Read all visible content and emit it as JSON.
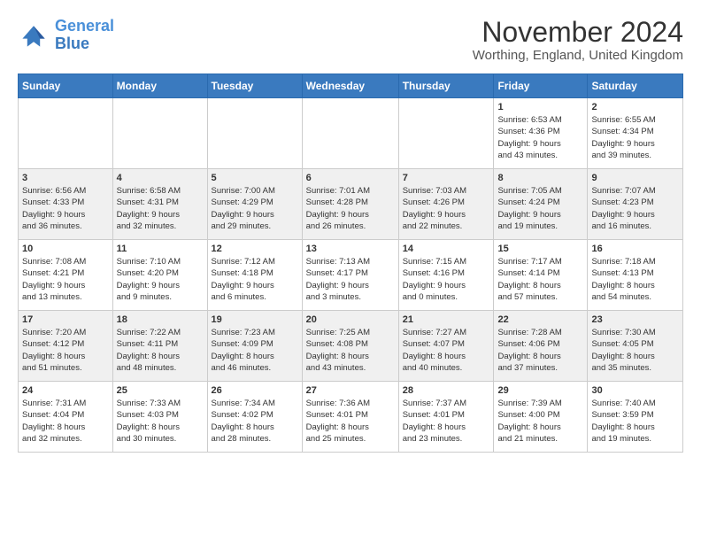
{
  "header": {
    "logo_line1": "General",
    "logo_line2": "Blue",
    "month": "November 2024",
    "location": "Worthing, England, United Kingdom"
  },
  "weekdays": [
    "Sunday",
    "Monday",
    "Tuesday",
    "Wednesday",
    "Thursday",
    "Friday",
    "Saturday"
  ],
  "weeks": [
    [
      {
        "day": "",
        "info": ""
      },
      {
        "day": "",
        "info": ""
      },
      {
        "day": "",
        "info": ""
      },
      {
        "day": "",
        "info": ""
      },
      {
        "day": "",
        "info": ""
      },
      {
        "day": "1",
        "info": "Sunrise: 6:53 AM\nSunset: 4:36 PM\nDaylight: 9 hours\nand 43 minutes."
      },
      {
        "day": "2",
        "info": "Sunrise: 6:55 AM\nSunset: 4:34 PM\nDaylight: 9 hours\nand 39 minutes."
      }
    ],
    [
      {
        "day": "3",
        "info": "Sunrise: 6:56 AM\nSunset: 4:33 PM\nDaylight: 9 hours\nand 36 minutes."
      },
      {
        "day": "4",
        "info": "Sunrise: 6:58 AM\nSunset: 4:31 PM\nDaylight: 9 hours\nand 32 minutes."
      },
      {
        "day": "5",
        "info": "Sunrise: 7:00 AM\nSunset: 4:29 PM\nDaylight: 9 hours\nand 29 minutes."
      },
      {
        "day": "6",
        "info": "Sunrise: 7:01 AM\nSunset: 4:28 PM\nDaylight: 9 hours\nand 26 minutes."
      },
      {
        "day": "7",
        "info": "Sunrise: 7:03 AM\nSunset: 4:26 PM\nDaylight: 9 hours\nand 22 minutes."
      },
      {
        "day": "8",
        "info": "Sunrise: 7:05 AM\nSunset: 4:24 PM\nDaylight: 9 hours\nand 19 minutes."
      },
      {
        "day": "9",
        "info": "Sunrise: 7:07 AM\nSunset: 4:23 PM\nDaylight: 9 hours\nand 16 minutes."
      }
    ],
    [
      {
        "day": "10",
        "info": "Sunrise: 7:08 AM\nSunset: 4:21 PM\nDaylight: 9 hours\nand 13 minutes."
      },
      {
        "day": "11",
        "info": "Sunrise: 7:10 AM\nSunset: 4:20 PM\nDaylight: 9 hours\nand 9 minutes."
      },
      {
        "day": "12",
        "info": "Sunrise: 7:12 AM\nSunset: 4:18 PM\nDaylight: 9 hours\nand 6 minutes."
      },
      {
        "day": "13",
        "info": "Sunrise: 7:13 AM\nSunset: 4:17 PM\nDaylight: 9 hours\nand 3 minutes."
      },
      {
        "day": "14",
        "info": "Sunrise: 7:15 AM\nSunset: 4:16 PM\nDaylight: 9 hours\nand 0 minutes."
      },
      {
        "day": "15",
        "info": "Sunrise: 7:17 AM\nSunset: 4:14 PM\nDaylight: 8 hours\nand 57 minutes."
      },
      {
        "day": "16",
        "info": "Sunrise: 7:18 AM\nSunset: 4:13 PM\nDaylight: 8 hours\nand 54 minutes."
      }
    ],
    [
      {
        "day": "17",
        "info": "Sunrise: 7:20 AM\nSunset: 4:12 PM\nDaylight: 8 hours\nand 51 minutes."
      },
      {
        "day": "18",
        "info": "Sunrise: 7:22 AM\nSunset: 4:11 PM\nDaylight: 8 hours\nand 48 minutes."
      },
      {
        "day": "19",
        "info": "Sunrise: 7:23 AM\nSunset: 4:09 PM\nDaylight: 8 hours\nand 46 minutes."
      },
      {
        "day": "20",
        "info": "Sunrise: 7:25 AM\nSunset: 4:08 PM\nDaylight: 8 hours\nand 43 minutes."
      },
      {
        "day": "21",
        "info": "Sunrise: 7:27 AM\nSunset: 4:07 PM\nDaylight: 8 hours\nand 40 minutes."
      },
      {
        "day": "22",
        "info": "Sunrise: 7:28 AM\nSunset: 4:06 PM\nDaylight: 8 hours\nand 37 minutes."
      },
      {
        "day": "23",
        "info": "Sunrise: 7:30 AM\nSunset: 4:05 PM\nDaylight: 8 hours\nand 35 minutes."
      }
    ],
    [
      {
        "day": "24",
        "info": "Sunrise: 7:31 AM\nSunset: 4:04 PM\nDaylight: 8 hours\nand 32 minutes."
      },
      {
        "day": "25",
        "info": "Sunrise: 7:33 AM\nSunset: 4:03 PM\nDaylight: 8 hours\nand 30 minutes."
      },
      {
        "day": "26",
        "info": "Sunrise: 7:34 AM\nSunset: 4:02 PM\nDaylight: 8 hours\nand 28 minutes."
      },
      {
        "day": "27",
        "info": "Sunrise: 7:36 AM\nSunset: 4:01 PM\nDaylight: 8 hours\nand 25 minutes."
      },
      {
        "day": "28",
        "info": "Sunrise: 7:37 AM\nSunset: 4:01 PM\nDaylight: 8 hours\nand 23 minutes."
      },
      {
        "day": "29",
        "info": "Sunrise: 7:39 AM\nSunset: 4:00 PM\nDaylight: 8 hours\nand 21 minutes."
      },
      {
        "day": "30",
        "info": "Sunrise: 7:40 AM\nSunset: 3:59 PM\nDaylight: 8 hours\nand 19 minutes."
      }
    ]
  ]
}
